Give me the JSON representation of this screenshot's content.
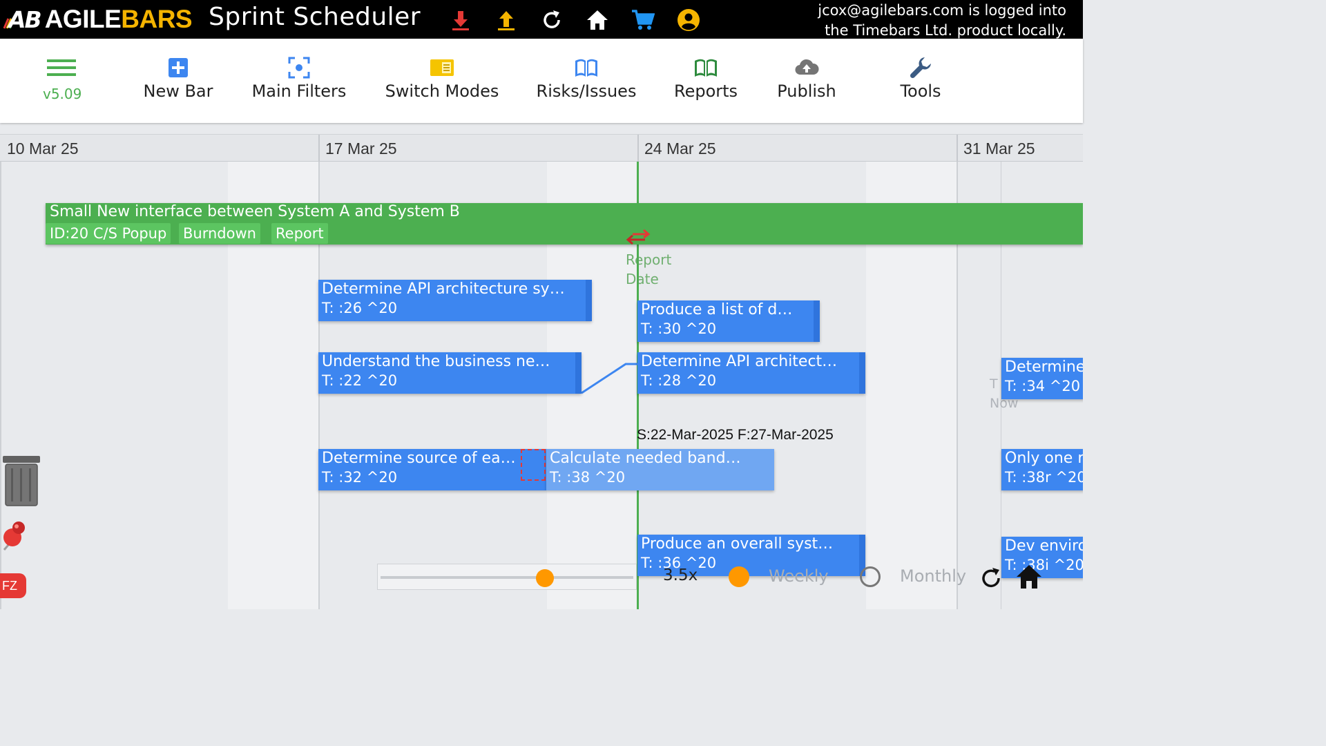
{
  "header": {
    "logo_mark": "AB",
    "logo_agile": "AGILE",
    "logo_bars": "BARS",
    "app_title": "Sprint Scheduler",
    "icons": [
      "download-icon",
      "upload-icon",
      "refresh-icon",
      "home-icon",
      "cart-icon",
      "account-icon"
    ],
    "login_line1": "jcox@agilebars.com is logged into",
    "login_line2": "the Timebars Ltd. product locally."
  },
  "toolbar": {
    "version": "v5.09",
    "new_bar": "New Bar",
    "main_filters": "Main Filters",
    "switch_modes": "Switch Modes",
    "risks_issues": "Risks/Issues",
    "reports": "Reports",
    "publish": "Publish",
    "tools": "Tools"
  },
  "timeline": {
    "dates": [
      "10 Mar 25",
      "17 Mar 25",
      "24 Mar 25",
      "31 Mar 25"
    ]
  },
  "feature": {
    "title": "Small New interface between System A and System B",
    "chip_popup": "ID:20 C/S Popup",
    "chip_burndown": "Burndown",
    "chip_report": "Report"
  },
  "markers": {
    "report_date_1": "Report",
    "report_date_2": "Date",
    "now_1": "T",
    "now_2": "Now",
    "selected_dates": "S:22-Mar-2025 F:27-Mar-2025"
  },
  "bars": [
    {
      "title": "Determine API architecture sy…",
      "sub": "T: :26 ^20"
    },
    {
      "title": "Produce a list of d…",
      "sub": "T: :30 ^20"
    },
    {
      "title": "Understand the business ne…",
      "sub": "T: :22 ^20"
    },
    {
      "title": "Determine API architect…",
      "sub": "T: :28 ^20"
    },
    {
      "title": "Determine",
      "sub": "T: :34 ^20"
    },
    {
      "title": "Determine source of ea…",
      "sub": "T: :32 ^20"
    },
    {
      "title": "Calculate needed band…",
      "sub": "T: :38 ^20"
    },
    {
      "title": "Only one r",
      "sub": "T: :38r ^20"
    },
    {
      "title": "Produce an overall syst…",
      "sub": "T: :36 ^20"
    },
    {
      "title": "Dev enviro",
      "sub": "T: :38i ^20"
    }
  ],
  "controls": {
    "zoom": "3.5x",
    "zoom_level": 0.65,
    "weekly": "Weekly",
    "monthly": "Monthly",
    "fz_badge": "FZ"
  },
  "colors": {
    "feature_green": "#4caf50",
    "bar_blue": "#3d86f0",
    "accent_orange": "#ff9800",
    "brand_yellow": "#f5b400"
  }
}
